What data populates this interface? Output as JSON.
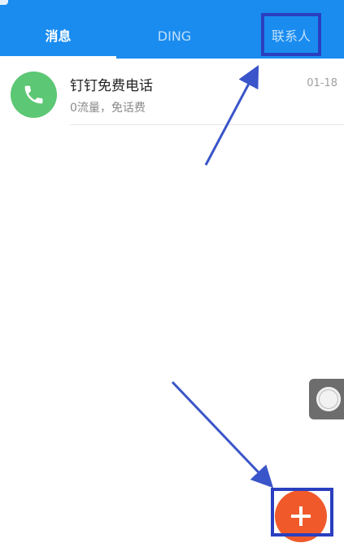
{
  "tabs": {
    "messages": "消息",
    "ding": "DING",
    "contacts": "联系人"
  },
  "conversations": [
    {
      "title": "钉钉免费电话",
      "subtitle": "0流量，免话费",
      "time": "01-18",
      "icon": "phone-icon"
    }
  ],
  "colors": {
    "header": "#1a8cf0",
    "avatar": "#5cc774",
    "fab": "#f05a2a",
    "annotation": "#2a3fbf"
  },
  "icons": {
    "fab": "plus-icon",
    "floating": "assistive-touch-icon"
  }
}
